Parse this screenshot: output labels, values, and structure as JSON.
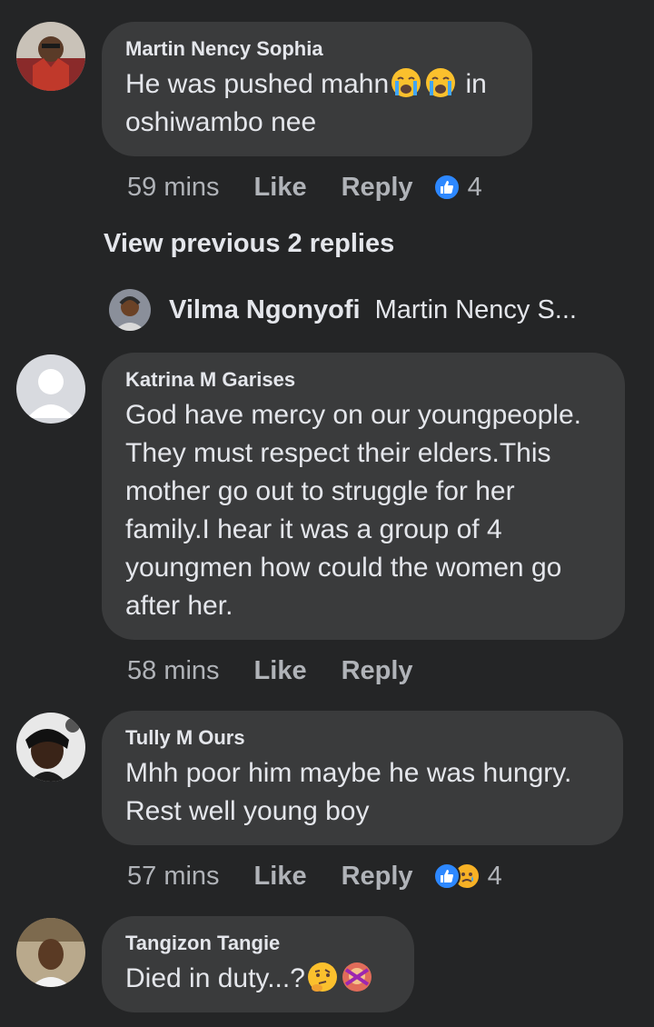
{
  "comments": [
    {
      "author": "Martin Nency Sophia",
      "text_before": "He was pushed mahn",
      "text_after": " in\noshiwambo nee",
      "time": "59 mins",
      "like_label": "Like",
      "reply_label": "Reply",
      "reaction_count": "4",
      "reactions": [
        "like-icon"
      ],
      "inline_emojis": [
        "loudly-crying-face-icon",
        "loudly-crying-face-icon"
      ]
    },
    {
      "author": "Katrina M Garises",
      "text": "God have mercy on our youngpeople.\nThey must respect their elders.This\nmother go out to struggle for her\nfamily.I hear it was a group of 4\nyoungmen how could the women go\nafter her.",
      "time": "58 mins",
      "like_label": "Like",
      "reply_label": "Reply"
    },
    {
      "author": "Tully M Ours",
      "text": "Mhh poor him maybe he was hungry.\nRest well young boy",
      "time": "57 mins",
      "like_label": "Like",
      "reply_label": "Reply",
      "reaction_count": "4",
      "reactions": [
        "like-icon",
        "sad-face-icon"
      ]
    },
    {
      "author": "Tangizon Tangie",
      "text": "Died in duty...?",
      "inline_emojis": [
        "thinking-face-icon",
        "woman-gesturing-no-icon"
      ]
    }
  ],
  "view_previous": "View previous 2 replies",
  "reply_preview": {
    "name": "Vilma Ngonyofi",
    "snippet": "Martin Nency S..."
  },
  "colors": {
    "background": "#242526",
    "bubble": "#3a3b3c",
    "primary_text": "#e4e6eb",
    "secondary_text": "#b0b3b8",
    "like_blue": "#2d88ff"
  }
}
